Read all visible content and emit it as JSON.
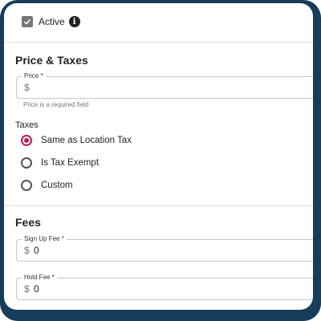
{
  "form": {
    "active_label": "Active",
    "info_glyph": "i",
    "active_checked": true
  },
  "price_section": {
    "title": "Price & Taxes",
    "price_field": {
      "label": "Price *",
      "currency": "$",
      "value": "",
      "helper": "Price is a required field"
    }
  },
  "taxes": {
    "label": "Taxes",
    "options": [
      {
        "label": "Same as Location Tax",
        "selected": true
      },
      {
        "label": "Is Tax Exempt",
        "selected": false
      },
      {
        "label": "Custom",
        "selected": false
      }
    ]
  },
  "fees_section": {
    "title": "Fees",
    "signup_fee": {
      "label": "Sign Up Fee *",
      "currency": "$",
      "value": "0"
    },
    "hold_fee": {
      "label": "Hold Fee *",
      "currency": "$",
      "value": "0"
    }
  },
  "colors": {
    "frame": "#183d5b",
    "radio_selected": "#c2185b",
    "checkbox": "#757575"
  },
  "icons": {
    "checkbox": "checkmark-icon",
    "info": "info-icon"
  }
}
